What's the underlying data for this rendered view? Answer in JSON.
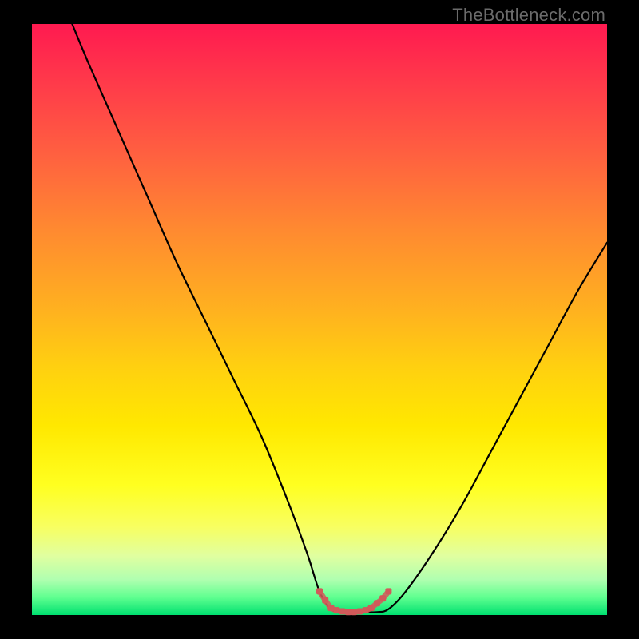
{
  "watermark": "TheBottleneck.com",
  "colors": {
    "background": "#000000",
    "gradient_top": "#ff1a50",
    "gradient_bottom": "#00e070",
    "curve": "#000000",
    "marker": "#d15a5a",
    "watermark_text": "#6b6b6b"
  },
  "chart_data": {
    "type": "line",
    "title": "",
    "xlabel": "",
    "ylabel": "",
    "xlim": [
      0,
      100
    ],
    "ylim": [
      0,
      100
    ],
    "series": [
      {
        "name": "bottleneck-curve",
        "x": [
          7,
          10,
          15,
          20,
          25,
          30,
          35,
          40,
          45,
          48,
          50,
          52,
          54,
          56,
          58,
          60,
          62,
          65,
          70,
          75,
          80,
          85,
          90,
          95,
          100
        ],
        "values": [
          100,
          93,
          82,
          71,
          60,
          50,
          40,
          30,
          18,
          10,
          4,
          1,
          0.5,
          0.5,
          0.5,
          0.5,
          1,
          4,
          11,
          19,
          28,
          37,
          46,
          55,
          63
        ]
      }
    ],
    "markers": {
      "name": "optimal-range",
      "x": [
        50,
        51,
        52,
        53,
        54,
        55,
        56,
        57,
        58,
        59,
        60,
        61,
        62
      ],
      "values": [
        4,
        2.5,
        1.2,
        0.8,
        0.6,
        0.5,
        0.5,
        0.6,
        0.8,
        1.2,
        2.0,
        2.8,
        4
      ]
    }
  }
}
